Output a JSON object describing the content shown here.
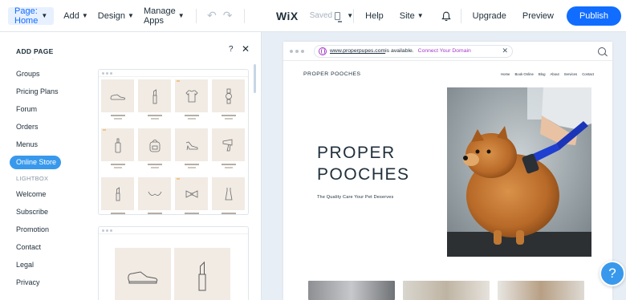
{
  "topbar": {
    "page_selector": "Page: Home",
    "menu": [
      "Add",
      "Design",
      "Manage Apps"
    ],
    "logo": "WiX",
    "saved": "Saved",
    "help": "Help",
    "site": "Site",
    "upgrade": "Upgrade",
    "preview": "Preview",
    "publish": "Publish"
  },
  "panel": {
    "title": "ADD PAGE",
    "help": "?",
    "close": "✕",
    "categories": {
      "groups": "Groups",
      "pricing_plans": "Pricing Plans",
      "forum": "Forum",
      "orders": "Orders",
      "menus": "Menus",
      "online_store": "Online Store",
      "lightbox": "LIGHTBOX",
      "welcome": "Welcome",
      "subscribe": "Subscribe",
      "promotion": "Promotion",
      "contact": "Contact",
      "legal": "Legal",
      "privacy": "Privacy"
    }
  },
  "site": {
    "url": "www.properpupes.com",
    "availability": " is available.",
    "connect": "Connect Your Domain",
    "logo": "PROPER POOCHES",
    "nav": [
      "Home",
      "Book Online",
      "Blog",
      "About",
      "Services",
      "Contact"
    ],
    "hero_line1": "PROPER",
    "hero_line2": "POOCHES",
    "hero_sub": "The Quality Care Your Pet Deserves"
  },
  "help_bubble": "?",
  "colors": {
    "accent": "#116dff",
    "active_pill": "#3899ec",
    "domain_link": "#a43ac8",
    "product_bg": "#f1ebe4"
  },
  "icons": [
    "chevron-down-icon",
    "undo-icon",
    "redo-icon",
    "desktop-icon",
    "bell-icon",
    "close-icon",
    "globe-icon",
    "zoom-icon"
  ]
}
